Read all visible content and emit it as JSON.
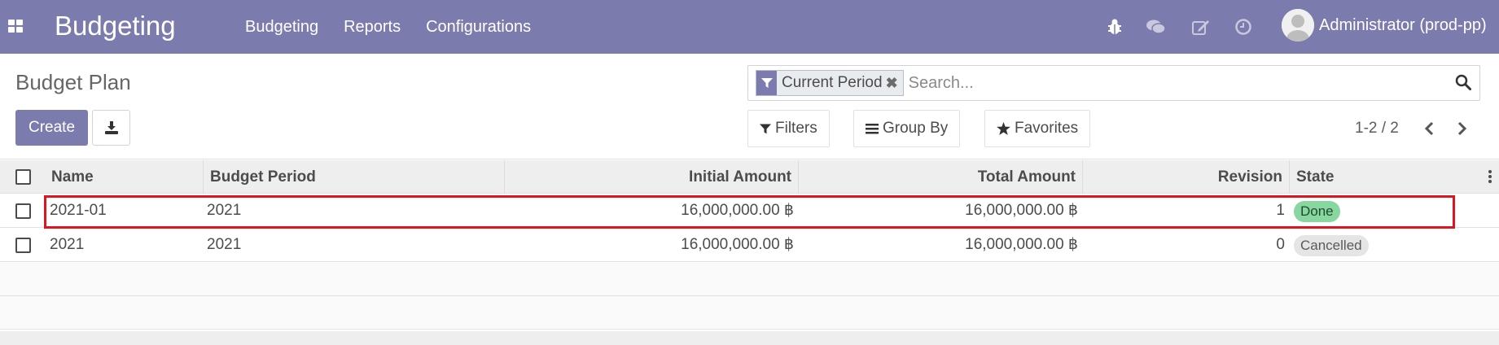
{
  "navbar": {
    "app_title": "Budgeting",
    "menu": [
      "Budgeting",
      "Reports",
      "Configurations"
    ],
    "icons": [
      "bug-icon",
      "chat-icon",
      "edit-icon",
      "clock-icon"
    ],
    "user_name": "Administrator (prod-pp)",
    "bg_color": "#7c7bad"
  },
  "control_panel": {
    "title": "Budget Plan",
    "create_label": "Create",
    "download_icon": "download-icon",
    "search": {
      "facet_label": "Current Period",
      "placeholder": "Search..."
    },
    "filters_label": "Filters",
    "group_by_label": "Group By",
    "favorites_label": "Favorites",
    "pager_value": "1-2 / 2"
  },
  "table": {
    "columns": [
      "Name",
      "Budget Period",
      "Initial Amount",
      "Total Amount",
      "Revision",
      "State"
    ],
    "rows": [
      {
        "name": "2021-01",
        "period": "2021",
        "initial": "16,000,000.00 ฿",
        "total": "16,000,000.00 ฿",
        "revision": "1",
        "state": "Done",
        "highlighted": true
      },
      {
        "name": "2021",
        "period": "2021",
        "initial": "16,000,000.00 ฿",
        "total": "16,000,000.00 ฿",
        "revision": "0",
        "state": "Cancelled",
        "highlighted": false
      }
    ]
  },
  "colors": {
    "accent": "#7c7bad",
    "done_badge": "#88d6a0",
    "cancelled_badge": "#e5e5e5",
    "highlight_border": "#e0141e"
  }
}
